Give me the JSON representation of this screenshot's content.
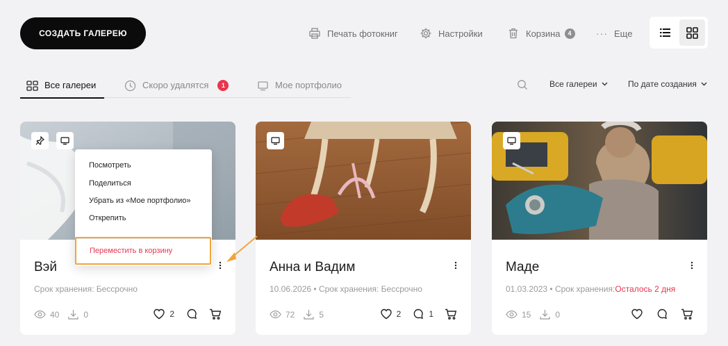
{
  "header": {
    "create_label": "СОЗДАТЬ ГАЛЕРЕЮ",
    "print_label": "Печать фотокниг",
    "settings_label": "Настройки",
    "trash_label": "Корзина",
    "trash_count": "4",
    "more_label": "Еще"
  },
  "tabs": {
    "all": "Все галереи",
    "soon_deleted": "Скоро удалятся",
    "soon_deleted_count": "1",
    "portfolio": "Мое портфолио"
  },
  "filters": {
    "type": "Все галереи",
    "sort": "По дате создания"
  },
  "cards": [
    {
      "title": "Вэй",
      "date": "",
      "storage": "Срок хранения: Бессрочно",
      "storage_warning": "",
      "views": "40",
      "downloads": "0",
      "likes": "2",
      "comments": ""
    },
    {
      "title": "Анна и Вадим",
      "date": "10.06.2026",
      "storage": "Срок хранения: Бессрочно",
      "storage_warning": "",
      "views": "72",
      "downloads": "5",
      "likes": "2",
      "comments": "1"
    },
    {
      "title": "Маде",
      "date": "01.03.2023",
      "storage": "Срок хранения:",
      "storage_warning": "Осталось 2 дня",
      "views": "15",
      "downloads": "0",
      "likes": "",
      "comments": ""
    }
  ],
  "context_menu": {
    "view": "Посмотреть",
    "share": "Поделиться",
    "remove_portfolio": "Убрать из «Мое портфолио»",
    "unpin": "Открепить",
    "move_trash": "Переместить в корзину"
  },
  "colors": {
    "accent_red": "#e8354e",
    "highlight_orange": "#f0a53b",
    "background": "#f2f2f4"
  }
}
